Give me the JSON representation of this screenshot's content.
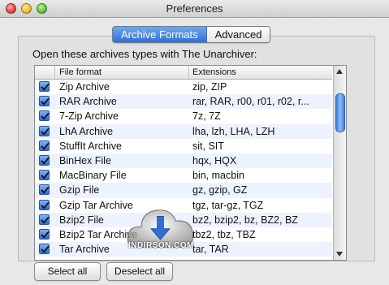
{
  "window": {
    "title": "Preferences"
  },
  "tabs": [
    {
      "label": "Archive Formats",
      "active": true
    },
    {
      "label": "Advanced",
      "active": false
    }
  ],
  "intro_text": "Open these archives types with The Unarchiver:",
  "table": {
    "columns": [
      "",
      "File format",
      "Extensions"
    ],
    "rows": [
      {
        "checked": true,
        "format": "Zip Archive",
        "extensions": "zip, ZIP"
      },
      {
        "checked": true,
        "format": "RAR Archive",
        "extensions": "rar, RAR, r00, r01, r02, r..."
      },
      {
        "checked": true,
        "format": "7-Zip Archive",
        "extensions": "7z, 7Z"
      },
      {
        "checked": true,
        "format": "LhA Archive",
        "extensions": "lha, lzh, LHA, LZH"
      },
      {
        "checked": true,
        "format": "StuffIt Archive",
        "extensions": "sit, SIT"
      },
      {
        "checked": true,
        "format": "BinHex File",
        "extensions": "hqx, HQX"
      },
      {
        "checked": true,
        "format": "MacBinary File",
        "extensions": "bin, macbin"
      },
      {
        "checked": true,
        "format": "Gzip File",
        "extensions": "gz, gzip, GZ"
      },
      {
        "checked": true,
        "format": "Gzip Tar Archive",
        "extensions": "tgz, tar-gz, TGZ"
      },
      {
        "checked": true,
        "format": "Bzip2 File",
        "extensions": "bz2, bzip2, bz, BZ2, BZ"
      },
      {
        "checked": true,
        "format": "Bzip2 Tar Archive",
        "extensions": "tbz2, tbz, TBZ"
      },
      {
        "checked": true,
        "format": "Tar Archive",
        "extensions": "tar, TAR"
      }
    ]
  },
  "buttons": {
    "select_all": "Select all",
    "deselect_all": "Deselect all"
  },
  "watermark": {
    "text": "INDIRSON.COM"
  },
  "colors": {
    "accent": "#2f6fd6",
    "row_alt": "#edf3fe",
    "window_bg": "#e8e8e8"
  }
}
